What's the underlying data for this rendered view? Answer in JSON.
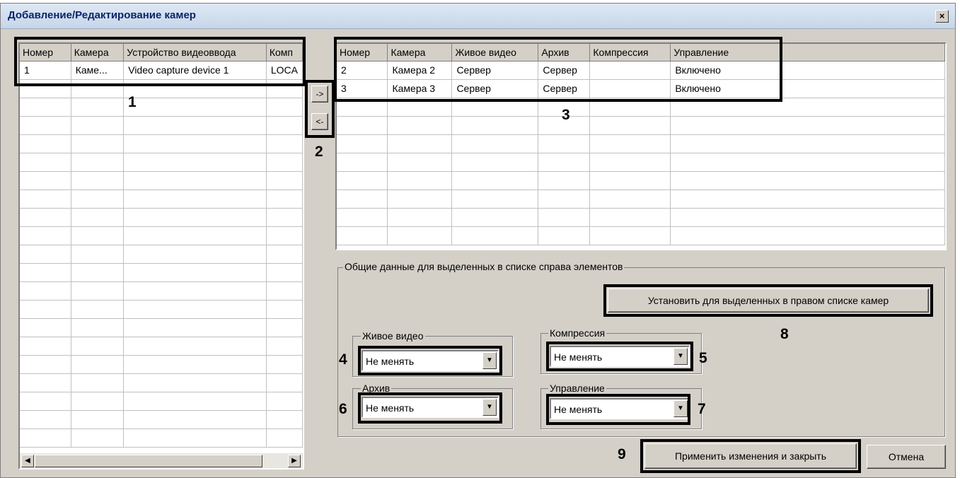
{
  "window": {
    "title": "Добавление/Редактирование камер",
    "close_label": "×"
  },
  "left_table": {
    "columns": [
      "Номер",
      "Камера",
      "Устройство видеоввода",
      "Комп"
    ],
    "rows": [
      [
        "1",
        "Каме...",
        "Video capture device 1",
        "LOCA"
      ]
    ]
  },
  "move_buttons": {
    "add_label": "->",
    "remove_label": "<-"
  },
  "right_table": {
    "columns": [
      "Номер",
      "Камера",
      "Живое видео",
      "Архив",
      "Компрессия",
      "Управление"
    ],
    "rows": [
      [
        "2",
        "Камера 2",
        "Сервер",
        "Сервер",
        "",
        "Включено"
      ],
      [
        "3",
        "Камера 3",
        "Сервер",
        "Сервер",
        "",
        "Включено"
      ]
    ]
  },
  "common_group": {
    "title": "Общие данные для выделенных в списке справа элементов",
    "apply_selected_label": "Установить для выделенных в правом списке камер",
    "live_video": {
      "label": "Живое видео",
      "value": "Не менять"
    },
    "compression": {
      "label": "Компрессия",
      "value": "Не менять"
    },
    "archive": {
      "label": "Архив",
      "value": "Не менять"
    },
    "control": {
      "label": "Управление",
      "value": "Не менять"
    }
  },
  "footer": {
    "apply_close_label": "Применить изменения и закрыть",
    "cancel_label": "Отмена"
  },
  "callouts": [
    "1",
    "2",
    "3",
    "4",
    "5",
    "6",
    "7",
    "8",
    "9"
  ]
}
